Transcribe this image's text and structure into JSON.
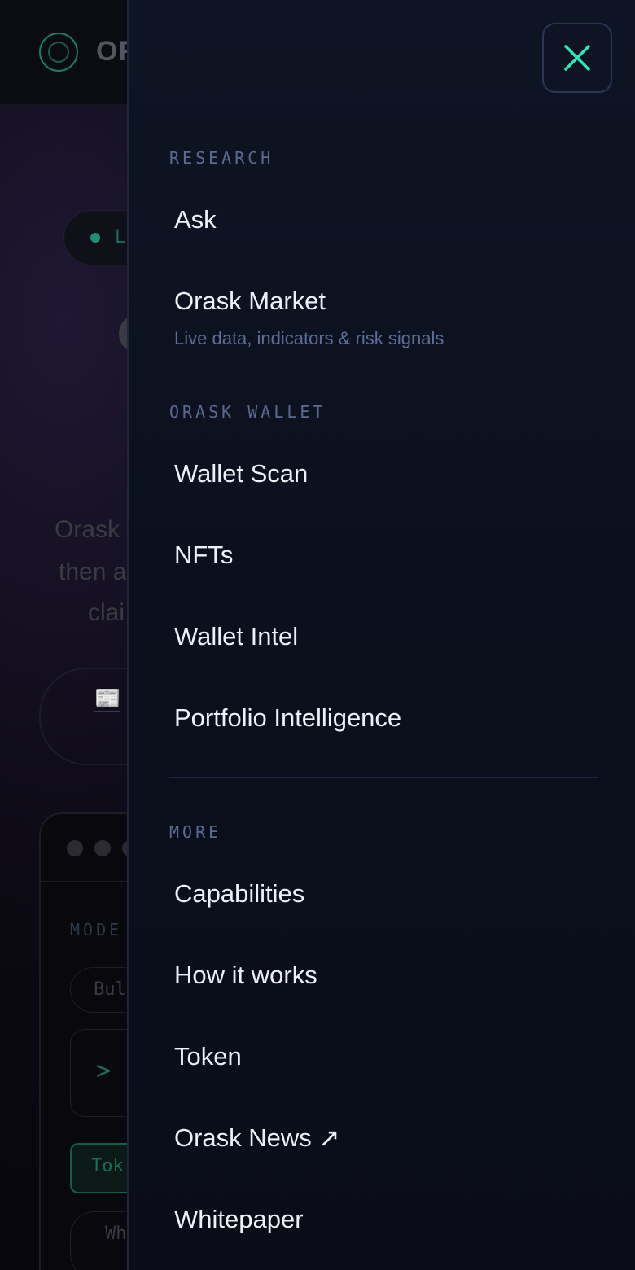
{
  "background": {
    "logo_text": "OR",
    "live_badge": "L",
    "hero_lines": [
      "Orask",
      "then a",
      "clai"
    ],
    "cta_icon": "📰",
    "mode_label": "MODE",
    "chips": [
      "Bul",
      "Wh"
    ],
    "prompt_symbol": ">",
    "token_chip": "Tok"
  },
  "drawer": {
    "close_icon": "close-icon",
    "sections": [
      {
        "label": "RESEARCH",
        "items": [
          {
            "label": "Ask"
          },
          {
            "label": "Orask Market",
            "sub": "Live data, indicators & risk signals"
          }
        ]
      },
      {
        "label": "ORASK WALLET",
        "items": [
          {
            "label": "Wallet Scan"
          },
          {
            "label": "NFTs"
          },
          {
            "label": "Wallet Intel"
          },
          {
            "label": "Portfolio Intelligence"
          }
        ]
      },
      {
        "label": "MORE",
        "items": [
          {
            "label": "Capabilities"
          },
          {
            "label": "How it works"
          },
          {
            "label": "Token"
          },
          {
            "label": "Orask News ↗"
          },
          {
            "label": "Whitepaper"
          }
        ]
      }
    ]
  },
  "colors": {
    "accent": "#2ee6b8",
    "drawer_bg": "#0f1424",
    "section_label": "#5c6a93",
    "item_text": "#eef1f8"
  }
}
